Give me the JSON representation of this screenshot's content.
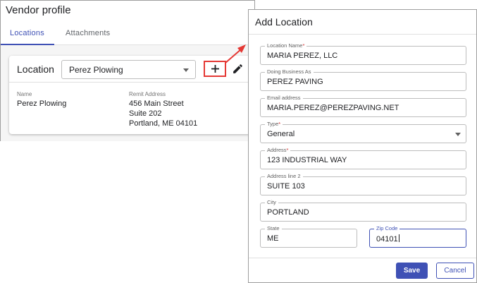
{
  "vendor": {
    "title": "Vendor profile",
    "tabs": [
      {
        "label": "Locations",
        "active": true
      },
      {
        "label": "Attachments",
        "active": false
      }
    ],
    "location_label": "Location",
    "location_select_value": "Perez Plowing",
    "add_button_symbol": "+",
    "details": {
      "name_label": "Name",
      "name_value": "Perez Plowing",
      "remit_label": "Remit Address",
      "remit_lines": [
        "456 Main Street",
        "Suite 202",
        "Portland, ME 04101"
      ]
    }
  },
  "dialog": {
    "title": "Add Location",
    "fields": {
      "location_name": {
        "label": "Location Name",
        "required": "*",
        "value": "MARIA PEREZ, LLC"
      },
      "doing_business_as": {
        "label": "Doing Business As",
        "value": "PEREZ PAVING"
      },
      "email": {
        "label": "Email address",
        "value": "MARIA.PEREZ@PEREZPAVING.NET"
      },
      "type": {
        "label": "Type",
        "required": "*",
        "value": "General"
      },
      "address": {
        "label": "Address",
        "required": "*",
        "value": "123 INDUSTRIAL WAY"
      },
      "address2": {
        "label": "Address line 2",
        "value": "SUITE 103"
      },
      "city": {
        "label": "City",
        "value": "PORTLAND"
      },
      "state": {
        "label": "State",
        "value": "ME"
      },
      "zip": {
        "label": "Zip Code",
        "value": "04101"
      }
    },
    "save_label": "Save",
    "cancel_label": "Cancel"
  },
  "colors": {
    "accent": "#3f51b5",
    "highlight": "#e53935",
    "required": "#d32f2f"
  },
  "icons": {
    "add": "plus-icon",
    "edit": "pencil-icon",
    "dropdown": "chevron-down-icon",
    "annotation": "arrow-icon"
  }
}
